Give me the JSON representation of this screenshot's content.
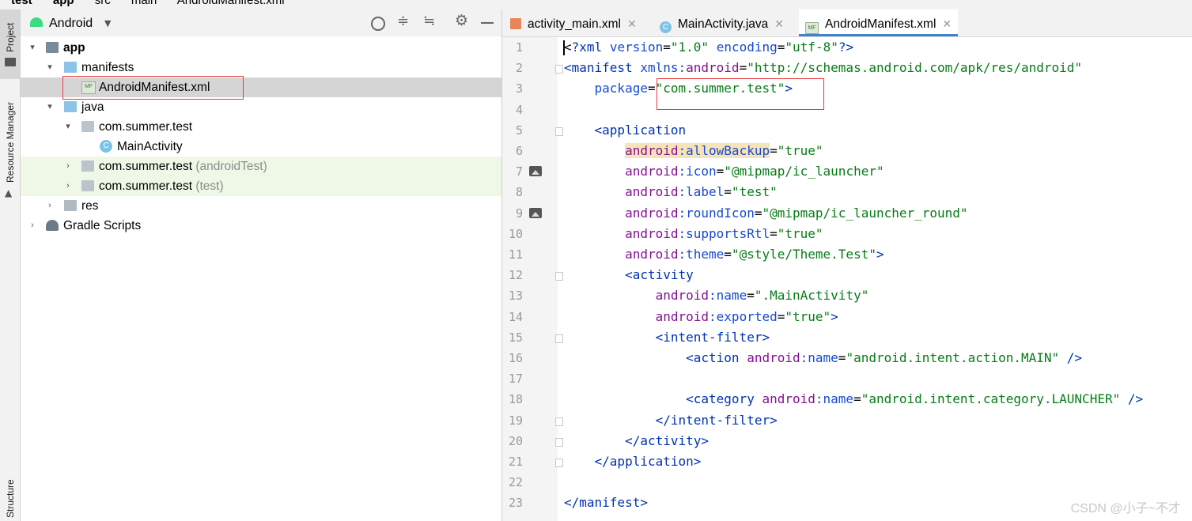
{
  "breadcrumb": [
    "test",
    "app",
    "src",
    "main",
    "AndroidManifest.xml"
  ],
  "tool_strip": {
    "project_label": "Project",
    "resource_manager_label": "Resource Manager",
    "structure_label": "Structure"
  },
  "project_panel": {
    "view_selector": "Android",
    "tree": [
      {
        "label": "app",
        "bold": true
      },
      {
        "label": "manifests"
      },
      {
        "label": "AndroidManifest.xml"
      },
      {
        "label": "java"
      },
      {
        "label": "com.summer.test"
      },
      {
        "label": "MainActivity"
      },
      {
        "label": "com.summer.test",
        "suffix": "(androidTest)"
      },
      {
        "label": "com.summer.test",
        "suffix": "(test)"
      },
      {
        "label": "res"
      },
      {
        "label": "Gradle Scripts"
      }
    ]
  },
  "editor": {
    "tabs": [
      {
        "label": "activity_main.xml",
        "active": false
      },
      {
        "label": "MainActivity.java",
        "active": false
      },
      {
        "label": "AndroidManifest.xml",
        "active": true
      }
    ],
    "lines": [
      [
        [
          "p",
          "<"
        ],
        [
          "t",
          "?xml "
        ],
        [
          "a",
          "version"
        ],
        [
          "p",
          "="
        ],
        [
          "s",
          "\"1.0\""
        ],
        [
          "p",
          " "
        ],
        [
          "a",
          "encoding"
        ],
        [
          "p",
          "="
        ],
        [
          "s",
          "\"utf-8\""
        ],
        [
          "t",
          "?>"
        ]
      ],
      [
        [
          "t",
          "<manifest "
        ],
        [
          "a",
          "xmlns:"
        ],
        [
          "n",
          "android"
        ],
        [
          "p",
          "="
        ],
        [
          "s",
          "\"http://schemas.android.com/apk/res/android\""
        ]
      ],
      [
        [
          "p",
          "    "
        ],
        [
          "a",
          "package"
        ],
        [
          "p",
          "="
        ],
        [
          "s",
          "\"com.summer.test\""
        ],
        [
          "t",
          ">"
        ]
      ],
      [],
      [
        [
          "p",
          "    "
        ],
        [
          "t",
          "<application"
        ]
      ],
      [
        [
          "p",
          "        "
        ],
        [
          "nh",
          "android"
        ],
        [
          "ah",
          ":allowBackup"
        ],
        [
          "p",
          "="
        ],
        [
          "s",
          "\"true\""
        ]
      ],
      [
        [
          "p",
          "        "
        ],
        [
          "n",
          "android"
        ],
        [
          "a",
          ":icon"
        ],
        [
          "p",
          "="
        ],
        [
          "s",
          "\"@mipmap/ic_launcher\""
        ]
      ],
      [
        [
          "p",
          "        "
        ],
        [
          "n",
          "android"
        ],
        [
          "a",
          ":label"
        ],
        [
          "p",
          "="
        ],
        [
          "s",
          "\"test\""
        ]
      ],
      [
        [
          "p",
          "        "
        ],
        [
          "n",
          "android"
        ],
        [
          "a",
          ":roundIcon"
        ],
        [
          "p",
          "="
        ],
        [
          "s",
          "\"@mipmap/ic_launcher_round\""
        ]
      ],
      [
        [
          "p",
          "        "
        ],
        [
          "n",
          "android"
        ],
        [
          "a",
          ":supportsRtl"
        ],
        [
          "p",
          "="
        ],
        [
          "s",
          "\"true\""
        ]
      ],
      [
        [
          "p",
          "        "
        ],
        [
          "n",
          "android"
        ],
        [
          "a",
          ":theme"
        ],
        [
          "p",
          "="
        ],
        [
          "s",
          "\"@style/Theme.Test\""
        ],
        [
          "t",
          ">"
        ]
      ],
      [
        [
          "p",
          "        "
        ],
        [
          "t",
          "<activity"
        ]
      ],
      [
        [
          "p",
          "            "
        ],
        [
          "n",
          "android"
        ],
        [
          "a",
          ":name"
        ],
        [
          "p",
          "="
        ],
        [
          "s",
          "\".MainActivity\""
        ]
      ],
      [
        [
          "p",
          "            "
        ],
        [
          "n",
          "android"
        ],
        [
          "a",
          ":exported"
        ],
        [
          "p",
          "="
        ],
        [
          "s",
          "\"true\""
        ],
        [
          "t",
          ">"
        ]
      ],
      [
        [
          "p",
          "            "
        ],
        [
          "t",
          "<intent-filter>"
        ]
      ],
      [
        [
          "p",
          "                "
        ],
        [
          "t",
          "<action "
        ],
        [
          "n",
          "android"
        ],
        [
          "a",
          ":name"
        ],
        [
          "p",
          "="
        ],
        [
          "s",
          "\"android.intent.action.MAIN\""
        ],
        [
          "p",
          " "
        ],
        [
          "t",
          "/>"
        ]
      ],
      [],
      [
        [
          "p",
          "                "
        ],
        [
          "t",
          "<category "
        ],
        [
          "n",
          "android"
        ],
        [
          "a",
          ":name"
        ],
        [
          "p",
          "="
        ],
        [
          "s",
          "\"android.intent.category.LAUNCHER\""
        ],
        [
          "p",
          " "
        ],
        [
          "t",
          "/>"
        ]
      ],
      [
        [
          "p",
          "            "
        ],
        [
          "t",
          "</intent-filter>"
        ]
      ],
      [
        [
          "p",
          "        "
        ],
        [
          "t",
          "</activity>"
        ]
      ],
      [
        [
          "p",
          "    "
        ],
        [
          "t",
          "</application>"
        ]
      ],
      [],
      [
        [
          "t",
          "</manifest>"
        ]
      ]
    ]
  },
  "watermark": "CSDN @小子~不才"
}
